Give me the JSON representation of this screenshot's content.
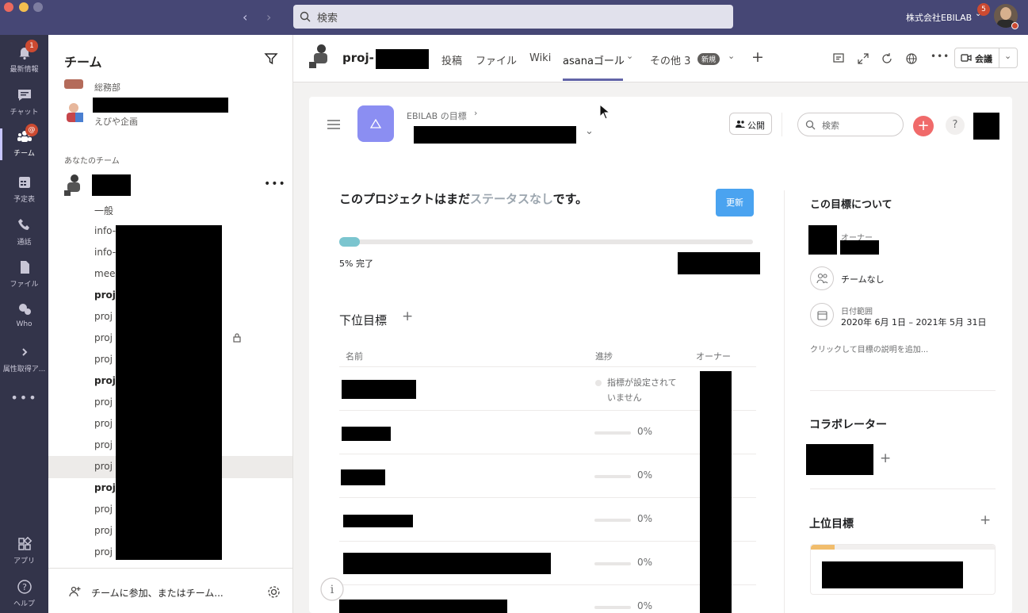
{
  "titlebar": {
    "search_placeholder": "検索",
    "org": "株式会社EBILAB",
    "notification_count": "5"
  },
  "rail": {
    "items": [
      {
        "label": "最新情報",
        "badge": "1"
      },
      {
        "label": "チャット"
      },
      {
        "label": "チーム",
        "badge": "@"
      },
      {
        "label": "予定表"
      },
      {
        "label": "通話"
      },
      {
        "label": "ファイル"
      },
      {
        "label": "Who"
      },
      {
        "label": "属性取得ア..."
      },
      {
        "label": "アプリ"
      },
      {
        "label": "ヘルプ"
      }
    ]
  },
  "teams": {
    "title": "チーム",
    "other_team_1": "総務部",
    "other_team_2": "えびや企画",
    "your_teams_header": "あなたのチーム",
    "channels": [
      "一般",
      "info-",
      "info-",
      "mee",
      "proj",
      "proj",
      "proj",
      "proj",
      "proj",
      "proj",
      "proj",
      "proj",
      "proj",
      "proj",
      "proj",
      "proj",
      "proj"
    ],
    "channel_bold": [
      false,
      false,
      false,
      false,
      true,
      false,
      false,
      false,
      true,
      false,
      false,
      false,
      false,
      true,
      false,
      false,
      false
    ],
    "footer": "チームに参加、またはチーム..."
  },
  "channel_header": {
    "name": "proj-",
    "tabs": [
      "投稿",
      "ファイル",
      "Wiki",
      "asanaゴール",
      "その他 3"
    ],
    "new_badge": "新規",
    "meet_label": "会議"
  },
  "asana": {
    "breadcrumb": "EBILAB の目標",
    "public_btn": "公開",
    "search_placeholder": "検索",
    "help": "?",
    "status": {
      "prefix": "このプロジェクトはまだ",
      "highlight": "ステータスなし",
      "suffix": "です。",
      "update_btn": "更新",
      "progress": 0.05,
      "progress_label": "5% 完了"
    },
    "subgoals": {
      "title": "下位目標",
      "columns": [
        "名前",
        "進捗",
        "オーナー"
      ],
      "rows": [
        {
          "progress_text": "指標が設定されていません"
        },
        {
          "progress_text": "0%"
        },
        {
          "progress_text": "0%"
        },
        {
          "progress_text": "0%"
        },
        {
          "progress_text": "0%"
        },
        {
          "progress_text": "0%"
        }
      ]
    },
    "about": {
      "title": "この目標について",
      "owner_label": "オーナー",
      "team": "チームなし",
      "date_label": "日付範囲",
      "date_range": "2020年 6月 1日 – 2021年 5月 31日",
      "description_hint": "クリックして目標の説明を追加..."
    },
    "collaborators_title": "コラボレーター",
    "parent_goals_title": "上位目標"
  }
}
